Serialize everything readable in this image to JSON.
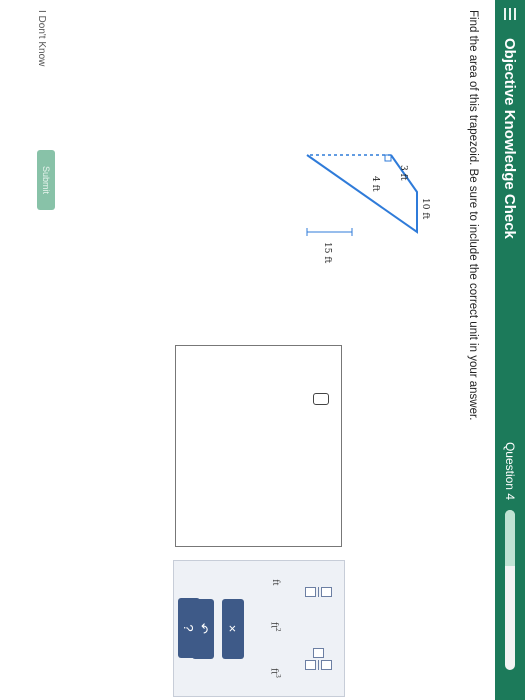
{
  "header": {
    "title": "Objective Knowledge Check",
    "question_label": "Question 4",
    "progress_fraction": 0.35,
    "menu_icon": "menu-icon"
  },
  "prompt": "Find the area of this trapezoid. Be sure to include the correct unit in your answer.",
  "figure": {
    "labels": {
      "top": "10 ft",
      "side": "3 ft",
      "bottom_segment": "4 ft",
      "height": "15 ft"
    },
    "stroke_color": "#2f7bd9"
  },
  "answer": {
    "value": ""
  },
  "toolbar": {
    "fraction_icon": "fraction-icon",
    "mixed_fraction_icon": "mixed-number-icon",
    "unit_ft": "ft",
    "unit_ft2": "ft",
    "unit_ft2_exp": "2",
    "unit_ft3": "ft",
    "unit_ft3_exp": "3",
    "clear_label": "×",
    "undo_label": "↶",
    "help_label": "?"
  },
  "footer": {
    "dont_know": "I Don't Know",
    "submit": "Submit"
  },
  "colors": {
    "brand": "#1c7a5a",
    "action": "#3e5a88"
  }
}
